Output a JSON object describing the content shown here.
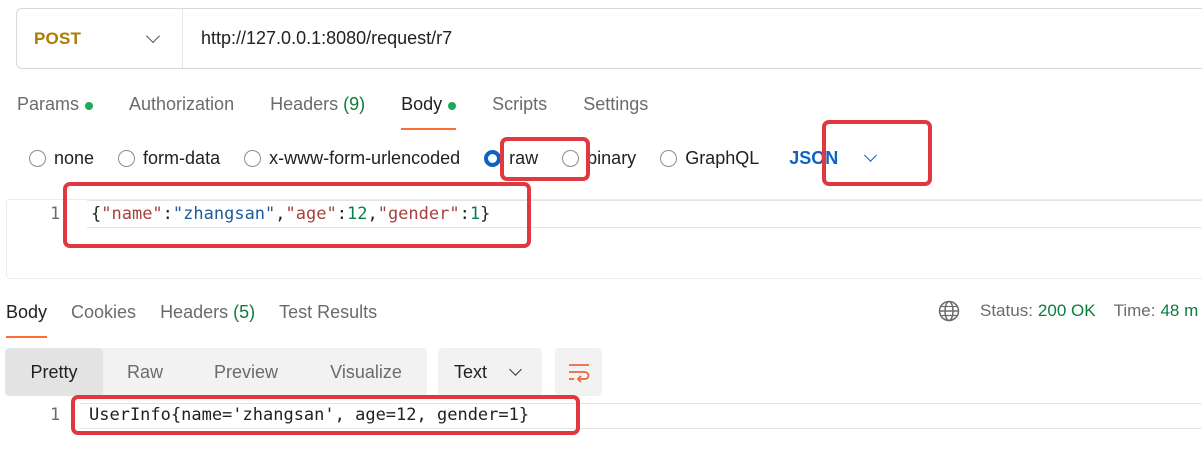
{
  "request": {
    "method": "POST",
    "url": "http://127.0.0.1:8080/request/r7"
  },
  "request_tabs": [
    {
      "label": "Params",
      "dot": true,
      "count": ""
    },
    {
      "label": "Authorization",
      "dot": false,
      "count": ""
    },
    {
      "label": "Headers",
      "dot": false,
      "count": "(9)"
    },
    {
      "label": "Body",
      "dot": true,
      "count": "",
      "active": true
    },
    {
      "label": "Scripts",
      "dot": false,
      "count": ""
    },
    {
      "label": "Settings",
      "dot": false,
      "count": ""
    }
  ],
  "body_types": [
    {
      "label": "none",
      "checked": false
    },
    {
      "label": "form-data",
      "checked": false
    },
    {
      "label": "x-www-form-urlencoded",
      "checked": false
    },
    {
      "label": "raw",
      "checked": true
    },
    {
      "label": "binary",
      "checked": false
    },
    {
      "label": "GraphQL",
      "checked": false
    }
  ],
  "raw_language": "JSON",
  "request_body": {
    "line_number": "1",
    "tokens": [
      {
        "t": "{",
        "c": "punc"
      },
      {
        "t": "\"name\"",
        "c": "key"
      },
      {
        "t": ":",
        "c": "punc"
      },
      {
        "t": "\"zhangsan\"",
        "c": "str"
      },
      {
        "t": ",",
        "c": "punc"
      },
      {
        "t": "\"age\"",
        "c": "key"
      },
      {
        "t": ":",
        "c": "punc"
      },
      {
        "t": "12",
        "c": "num"
      },
      {
        "t": ",",
        "c": "punc"
      },
      {
        "t": "\"gender\"",
        "c": "key"
      },
      {
        "t": ":",
        "c": "punc"
      },
      {
        "t": "1",
        "c": "num"
      },
      {
        "t": "}",
        "c": "punc"
      }
    ]
  },
  "response_tabs": [
    {
      "label": "Body",
      "count": "",
      "active": true
    },
    {
      "label": "Cookies",
      "count": ""
    },
    {
      "label": "Headers",
      "count": "(5)"
    },
    {
      "label": "Test Results",
      "count": ""
    }
  ],
  "response_status": {
    "status_label": "Status:",
    "status_value": "200 OK",
    "time_label": "Time:",
    "time_value": "48 m"
  },
  "view_modes": [
    {
      "label": "Pretty",
      "active": true
    },
    {
      "label": "Raw",
      "active": false
    },
    {
      "label": "Preview",
      "active": false
    },
    {
      "label": "Visualize",
      "active": false
    }
  ],
  "response_format": "Text",
  "response_body": {
    "line_number": "1",
    "text": "UserInfo{name='zhangsan', age=12, gender=1}"
  },
  "colors": {
    "method": "#ad7a03",
    "accent_tab": "#ff6c37",
    "status_ok": "#0a7d3d",
    "highlight": "#e0383f",
    "link_blue": "#0b63c7"
  },
  "icons": {
    "method_dropdown": "chevron-down-icon",
    "language_dropdown": "chevron-down-icon",
    "network": "globe-icon",
    "wrap": "wrap-lines-icon"
  }
}
